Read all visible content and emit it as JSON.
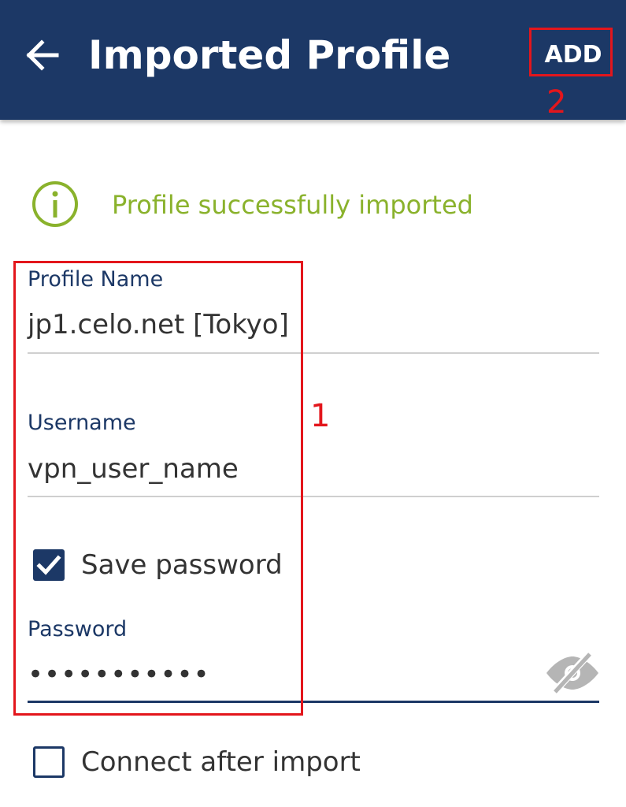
{
  "appbar": {
    "title": "Imported Profile",
    "add_label": "ADD",
    "back_icon": "arrow-left-icon",
    "background": "#1c3866"
  },
  "notice": {
    "icon": "info-icon",
    "text": "Profile successfully imported",
    "color": "#8ab22c"
  },
  "form": {
    "profile_name": {
      "label": "Profile Name",
      "value": "jp1.celo.net [Tokyo]"
    },
    "username": {
      "label": "Username",
      "value": "vpn_user_name"
    },
    "save_password": {
      "label": "Save password",
      "checked": true
    },
    "password": {
      "label": "Password",
      "value": "•••••••••••",
      "visibility_icon": "eye-off-icon"
    },
    "connect_after_import": {
      "label": "Connect after import",
      "checked": false
    }
  },
  "annotations": {
    "box1_number": "1",
    "box2_number": "2",
    "color": "#e3161c"
  }
}
